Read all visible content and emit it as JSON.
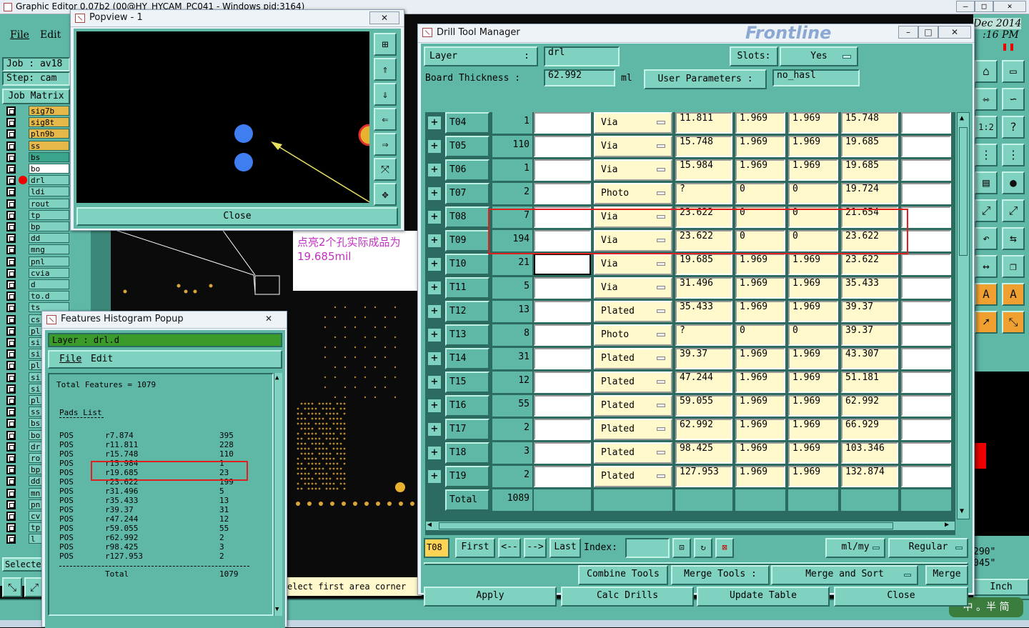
{
  "main_window": {
    "title": "Graphic Editor 0.07b2 (00@HY_HYCAM_PC041 - Windows pid:3164)",
    "menu": [
      "File",
      "Edit"
    ],
    "job_label": "Job",
    "job_value": "av18",
    "step_label": "Step:",
    "step_value": "cam",
    "job_matrix": "Job Matrix",
    "date": "Dec 2014",
    "time": ":16 PM",
    "select_label": "Selecte",
    "coord_x": "290\"",
    "coord_y": "045\"",
    "units": "Inch",
    "status_msg": "elect first area corner",
    "annotation": "点亮2个孔实际成品为19.685mil",
    "watermark": "中 。半 简"
  },
  "layers": [
    {
      "name": "sig7b",
      "color": "#e6b84a"
    },
    {
      "name": "sig8t",
      "color": "#e6b84a"
    },
    {
      "name": "pln9b",
      "color": "#e6b84a"
    },
    {
      "name": "ss",
      "color": "#e6b84a"
    },
    {
      "name": "bs",
      "color": "#3aa58a"
    },
    {
      "name": "bo",
      "color": "#ffffff"
    },
    {
      "name": "drl",
      "color": "#7fd1c0"
    },
    {
      "name": "ldi",
      "color": "#7fd1c0"
    },
    {
      "name": "rout",
      "color": "#7fd1c0"
    },
    {
      "name": "tp",
      "color": "#7fd1c0"
    },
    {
      "name": "bp",
      "color": "#7fd1c0"
    },
    {
      "name": "dd",
      "color": "#7fd1c0"
    },
    {
      "name": "mng",
      "color": "#7fd1c0"
    },
    {
      "name": "pnl",
      "color": "#7fd1c0"
    },
    {
      "name": "cvia",
      "color": "#7fd1c0"
    },
    {
      "name": "d",
      "color": "#7fd1c0"
    },
    {
      "name": "to.d",
      "color": "#7fd1c0"
    },
    {
      "name": "ts",
      "color": "#7fd1c0"
    },
    {
      "name": "cs",
      "color": "#7fd1c0"
    },
    {
      "name": "pl",
      "color": "#7fd1c0"
    },
    {
      "name": "si",
      "color": "#7fd1c0"
    },
    {
      "name": "si",
      "color": "#7fd1c0"
    },
    {
      "name": "pl",
      "color": "#7fd1c0"
    },
    {
      "name": "si",
      "color": "#7fd1c0"
    },
    {
      "name": "si",
      "color": "#7fd1c0"
    },
    {
      "name": "pl",
      "color": "#7fd1c0"
    },
    {
      "name": "ss",
      "color": "#7fd1c0"
    },
    {
      "name": "bs",
      "color": "#7fd1c0"
    },
    {
      "name": "bo",
      "color": "#7fd1c0"
    },
    {
      "name": "dr",
      "color": "#7fd1c0"
    },
    {
      "name": "ro",
      "color": "#7fd1c0"
    },
    {
      "name": "bp",
      "color": "#7fd1c0"
    },
    {
      "name": "dd",
      "color": "#7fd1c0"
    },
    {
      "name": "mn",
      "color": "#7fd1c0"
    },
    {
      "name": "pn",
      "color": "#7fd1c0"
    },
    {
      "name": "cv",
      "color": "#7fd1c0"
    },
    {
      "name": "tp",
      "color": "#7fd1c0"
    },
    {
      "name": "l",
      "color": "#7fd1c0"
    }
  ],
  "popview": {
    "title": "Popview - 1",
    "close": "Close"
  },
  "histogram": {
    "title": "Features Histogram Popup",
    "layer_label": "Layer :",
    "layer_value": "drl.d",
    "menu": [
      "File",
      "Edit"
    ],
    "total_features": "Total Features = 1079",
    "pads_list": "Pads List",
    "rows": [
      {
        "type": "POS",
        "sym": "r7.874",
        "count": "395"
      },
      {
        "type": "POS",
        "sym": "r11.811",
        "count": "228"
      },
      {
        "type": "POS",
        "sym": "r15.748",
        "count": "110"
      },
      {
        "type": "POS",
        "sym": "r15.984",
        "count": "1"
      },
      {
        "type": "POS",
        "sym": "r19.685",
        "count": "23"
      },
      {
        "type": "POS",
        "sym": "r23.622",
        "count": "199"
      },
      {
        "type": "POS",
        "sym": "r31.496",
        "count": "5"
      },
      {
        "type": "POS",
        "sym": "r35.433",
        "count": "13"
      },
      {
        "type": "POS",
        "sym": "r39.37",
        "count": "31"
      },
      {
        "type": "POS",
        "sym": "r47.244",
        "count": "12"
      },
      {
        "type": "POS",
        "sym": "r59.055",
        "count": "55"
      },
      {
        "type": "POS",
        "sym": "r62.992",
        "count": "2"
      },
      {
        "type": "POS",
        "sym": "r98.425",
        "count": "3"
      },
      {
        "type": "POS",
        "sym": "r127.953",
        "count": "2"
      }
    ],
    "total_label": "Total",
    "total_value": "1079"
  },
  "dtm": {
    "title": "Drill Tool Manager",
    "brand": "Frontline",
    "layer_label": "Layer",
    "layer_colon": ":",
    "layer_value": "drl",
    "slots_label": "Slots:",
    "slots_value": "Yes",
    "board_thickness_label": "Board Thickness",
    "board_thickness_colon": ":",
    "board_thickness_value": "62.992",
    "board_thickness_unit": "ml",
    "user_params_label": "User Parameters",
    "user_params_colon": ":",
    "user_params_value": "no_hasl",
    "rows": [
      {
        "tool": "T04",
        "count": "1",
        "type": "Via",
        "d1": "11.811",
        "p": "1.969",
        "m": "1.969",
        "d2": "15.748"
      },
      {
        "tool": "T05",
        "count": "110",
        "type": "Via",
        "d1": "15.748",
        "p": "1.969",
        "m": "1.969",
        "d2": "19.685"
      },
      {
        "tool": "T06",
        "count": "1",
        "type": "Via",
        "d1": "15.984",
        "p": "1.969",
        "m": "1.969",
        "d2": "19.685"
      },
      {
        "tool": "T07",
        "count": "2",
        "type": "Photo",
        "d1": "?",
        "p": "0",
        "m": "0",
        "d2": "19.724"
      },
      {
        "tool": "T08",
        "count": "7",
        "type": "Via",
        "d1": "23.622",
        "p": "0",
        "m": "0",
        "d2": "21.654"
      },
      {
        "tool": "T09",
        "count": "194",
        "type": "Via",
        "d1": "23.622",
        "p": "0",
        "m": "0",
        "d2": "23.622"
      },
      {
        "tool": "T10",
        "count": "21",
        "type": "Via",
        "d1": "19.685",
        "p": "1.969",
        "m": "1.969",
        "d2": "23.622"
      },
      {
        "tool": "T11",
        "count": "5",
        "type": "Via",
        "d1": "31.496",
        "p": "1.969",
        "m": "1.969",
        "d2": "35.433"
      },
      {
        "tool": "T12",
        "count": "13",
        "type": "Plated",
        "d1": "35.433",
        "p": "1.969",
        "m": "1.969",
        "d2": "39.37"
      },
      {
        "tool": "T13",
        "count": "8",
        "type": "Photo",
        "d1": "?",
        "p": "0",
        "m": "0",
        "d2": "39.37"
      },
      {
        "tool": "T14",
        "count": "31",
        "type": "Plated",
        "d1": "39.37",
        "p": "1.969",
        "m": "1.969",
        "d2": "43.307"
      },
      {
        "tool": "T15",
        "count": "12",
        "type": "Plated",
        "d1": "47.244",
        "p": "1.969",
        "m": "1.969",
        "d2": "51.181"
      },
      {
        "tool": "T16",
        "count": "55",
        "type": "Plated",
        "d1": "59.055",
        "p": "1.969",
        "m": "1.969",
        "d2": "62.992"
      },
      {
        "tool": "T17",
        "count": "2",
        "type": "Plated",
        "d1": "62.992",
        "p": "1.969",
        "m": "1.969",
        "d2": "66.929"
      },
      {
        "tool": "T18",
        "count": "3",
        "type": "Plated",
        "d1": "98.425",
        "p": "1.969",
        "m": "1.969",
        "d2": "103.346"
      },
      {
        "tool": "T19",
        "count": "2",
        "type": "Plated",
        "d1": "127.953",
        "p": "1.969",
        "m": "1.969",
        "d2": "132.874"
      }
    ],
    "total_label": "Total",
    "total_value": "1089",
    "current_tool": "T08",
    "first": "First",
    "prev": "<--",
    "next": "-->",
    "last": "Last",
    "index_label": "Index:",
    "units": "ml/my",
    "mode": "Regular",
    "combine_tools": "Combine Tools",
    "merge_tools_label": "Merge Tools :",
    "merge_mode": "Merge and Sort",
    "merge": "Merge",
    "apply": "Apply",
    "calc_drills": "Calc Drills",
    "update_table": "Update Table",
    "close": "Close"
  }
}
